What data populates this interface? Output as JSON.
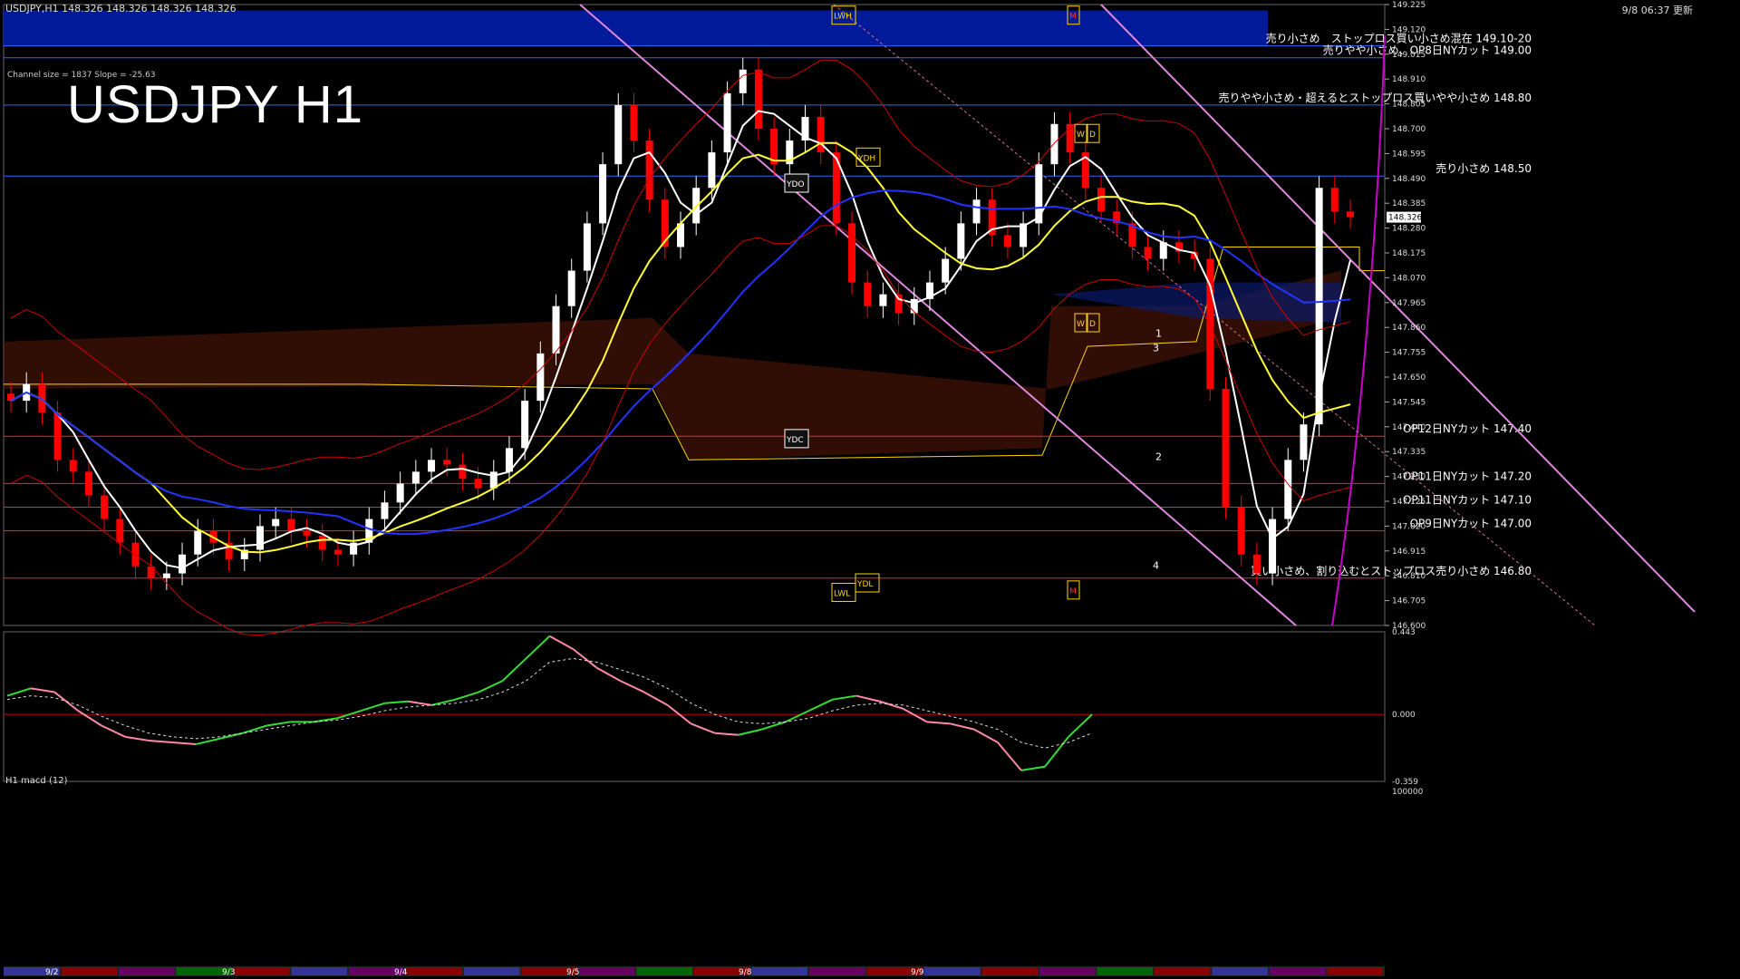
{
  "header": {
    "symbol_info": "USDJPY,H1  148.326 148.326 148.326 148.326",
    "right_info": "9/8 06:37 更新",
    "channel_info": "Channel size = 1837 Slope = -25.63",
    "title": "USDJPY H1",
    "macd_label": "H1  macd (12)"
  },
  "chart_data": {
    "type": "candlestick",
    "symbol": "USDJPY",
    "timeframe": "H1",
    "current_price": 148.326,
    "ylim": [
      146.6,
      149.225
    ],
    "y_ticks": [
      149.225,
      149.12,
      149.015,
      148.91,
      148.805,
      148.7,
      148.595,
      148.49,
      148.385,
      148.28,
      148.175,
      148.07,
      147.965,
      147.86,
      147.755,
      147.65,
      147.545,
      147.44,
      147.335,
      147.23,
      147.125,
      147.02,
      146.915,
      146.81,
      146.705,
      146.6
    ],
    "x_labels": [
      "9/2",
      "9/3",
      "9/4",
      "9/5",
      "9/8",
      "9/9"
    ],
    "close_path": [
      147.55,
      147.62,
      147.5,
      147.3,
      147.25,
      147.15,
      147.05,
      146.95,
      146.85,
      146.8,
      146.82,
      146.9,
      147.0,
      146.95,
      146.88,
      146.92,
      147.02,
      147.05,
      147.0,
      146.98,
      146.92,
      146.9,
      146.95,
      147.05,
      147.12,
      147.2,
      147.25,
      147.3,
      147.28,
      147.22,
      147.18,
      147.25,
      147.35,
      147.55,
      147.75,
      147.95,
      148.1,
      148.3,
      148.55,
      148.8,
      148.65,
      148.4,
      148.2,
      148.3,
      148.45,
      148.6,
      148.85,
      148.95,
      148.7,
      148.55,
      148.65,
      148.75,
      148.6,
      148.3,
      148.05,
      147.95,
      148.0,
      147.92,
      147.98,
      148.05,
      148.15,
      148.3,
      148.4,
      148.25,
      148.2,
      148.3,
      148.55,
      148.72,
      148.6,
      148.45,
      148.35,
      148.3,
      148.2,
      148.15,
      148.22,
      148.18,
      148.15,
      147.6,
      147.1,
      146.9,
      146.82,
      147.05,
      147.3,
      147.45,
      148.45,
      148.35,
      148.326
    ],
    "resistance_levels": [
      {
        "price": 149.05,
        "label": "売り小さめ　ストップロス買い小さめ混在 149.10-20",
        "color": "#3366ff"
      },
      {
        "price": 149.0,
        "label": "売りやや小さめ、OP8日NYカット 149.00",
        "color": "#3366ff"
      },
      {
        "price": 148.8,
        "label": "売りやや小さめ・超えるとストップロス買いやや小さめ 148.80",
        "color": "#3366ff"
      },
      {
        "price": 148.5,
        "label": "売り小さめ 148.50",
        "color": "#3366ff"
      },
      {
        "price": 147.4,
        "label": "OP12日NYカット 147.40",
        "color": "#ff2222"
      },
      {
        "price": 147.2,
        "label": "OP11日NYカット 147.20",
        "color": "#ff2222"
      },
      {
        "price": 147.1,
        "label": "OP11日NYカット 147.10",
        "color": "#ff2222"
      },
      {
        "price": 147.0,
        "label": "OP9日NYカット 147.00",
        "color": "#ff2222"
      },
      {
        "price": 146.8,
        "label": "買い小さめ、割り込むとストップロス売り小さめ 146.80",
        "color": "#ff2222"
      }
    ],
    "markers": [
      {
        "label": "LWH",
        "price": 149.18
      },
      {
        "label": "YDH",
        "price": 148.58
      },
      {
        "label": "YDO",
        "price": 148.47
      },
      {
        "label": "YDC",
        "price": 147.39
      },
      {
        "label": "YDL",
        "price": 146.78
      },
      {
        "label": "LWL",
        "price": 146.74
      },
      {
        "label": "W",
        "price": 148.68
      },
      {
        "label": "D",
        "price": 148.68
      },
      {
        "label": "W",
        "price": 147.88
      },
      {
        "label": "D",
        "price": 147.88
      },
      {
        "label": "M",
        "price": 149.18
      },
      {
        "label": "M",
        "price": 146.75
      }
    ],
    "channel_labels": [
      "1",
      "2",
      "3",
      "4"
    ],
    "macd": {
      "ylim": [
        -0.359,
        0.443
      ],
      "y_ticks": [
        0.443,
        0.0,
        -0.359
      ],
      "bottom_value": "100000",
      "macd_line": [
        0.1,
        0.14,
        0.12,
        0.02,
        -0.06,
        -0.12,
        -0.14,
        -0.15,
        -0.16,
        -0.13,
        -0.1,
        -0.06,
        -0.04,
        -0.04,
        -0.02,
        0.02,
        0.06,
        0.07,
        0.05,
        0.08,
        0.12,
        0.18,
        0.3,
        0.42,
        0.35,
        0.25,
        0.18,
        0.12,
        0.05,
        -0.05,
        -0.1,
        -0.11,
        -0.08,
        -0.04,
        0.02,
        0.08,
        0.1,
        0.07,
        0.03,
        -0.04,
        -0.05,
        -0.08,
        -0.15,
        -0.3,
        -0.28,
        -0.12,
        0.0
      ],
      "signal_line": [
        0.08,
        0.1,
        0.09,
        0.05,
        -0.01,
        -0.06,
        -0.1,
        -0.12,
        -0.13,
        -0.12,
        -0.1,
        -0.08,
        -0.06,
        -0.04,
        -0.03,
        -0.01,
        0.02,
        0.04,
        0.05,
        0.06,
        0.08,
        0.12,
        0.18,
        0.28,
        0.3,
        0.28,
        0.24,
        0.2,
        0.14,
        0.06,
        0.0,
        -0.04,
        -0.05,
        -0.04,
        -0.02,
        0.02,
        0.05,
        0.06,
        0.05,
        0.02,
        -0.01,
        -0.04,
        -0.08,
        -0.15,
        -0.18,
        -0.15,
        -0.1
      ]
    }
  },
  "colors": {
    "up": "#ffffff",
    "down": "#ff0000",
    "ma_fast": "#ffffff",
    "ma_mid": "#ffff33",
    "ma_slow": "#2233ff",
    "bollinger": "#cc0000",
    "channel": "#dd88dd",
    "cloud": "#ffd700",
    "macd_up": "#33dd33",
    "macd_down": "#ff88aa",
    "grid_line": "#3366ff"
  }
}
